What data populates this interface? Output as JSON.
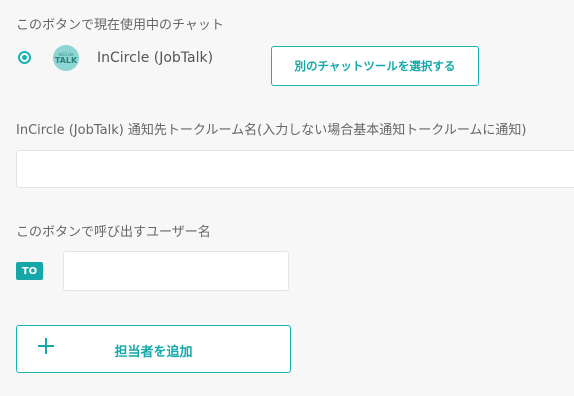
{
  "current_chat": {
    "label": "このボタンで現在使用中のチャット",
    "app_name": "InCircle (JobTalk)",
    "icon_small_text": "InCircle",
    "icon_big_text": "TALK",
    "select_button": "別のチャットツールを選択する"
  },
  "destination": {
    "label": "InCircle (JobTalk) 通知先トークルーム名(入力しない場合基本通知トークルームに通知)",
    "value": "",
    "placeholder": ""
  },
  "mention": {
    "label": "このボタンで呼び出すユーザー名",
    "badge": "TO",
    "value": "",
    "placeholder": ""
  },
  "add_assignee": {
    "label": "担当者を追加",
    "icon": "plus-icon"
  },
  "colors": {
    "accent": "#16a8a8",
    "background": "#f7f7f8"
  }
}
